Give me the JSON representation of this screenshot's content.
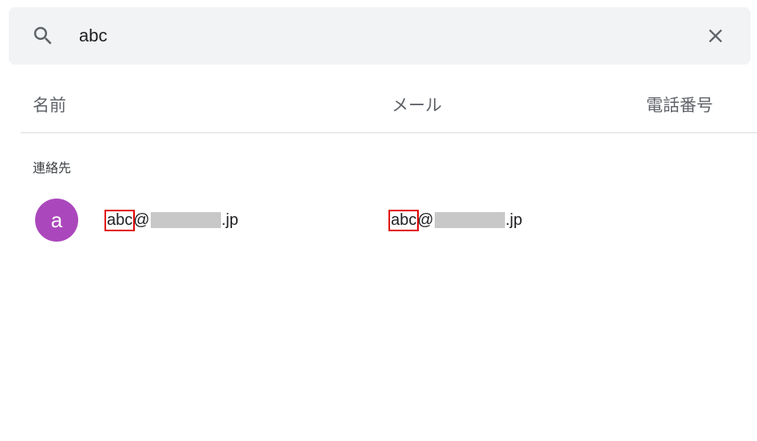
{
  "search": {
    "query": "abc",
    "icon": "search-icon",
    "clear_icon": "close-icon"
  },
  "columns": {
    "name": "名前",
    "email": "メール",
    "phone": "電話番号"
  },
  "section": {
    "label": "連絡先"
  },
  "results": [
    {
      "avatar_letter": "a",
      "avatar_color": "#ab47bc",
      "name_prefix": "abc",
      "name_at": "@",
      "name_suffix": ".jp",
      "email_prefix": "abc",
      "email_at": "@",
      "email_suffix": ".jp"
    }
  ],
  "colors": {
    "search_bg": "#f1f3f4",
    "highlight_border": "#e00000",
    "redaction": "#c8c8c8"
  }
}
